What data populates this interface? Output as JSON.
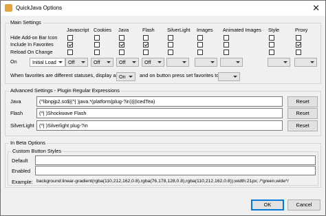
{
  "window": {
    "title": "QuickJava Options",
    "close_glyph": "✕"
  },
  "main_settings": {
    "label": "Main Settings",
    "columns": [
      "Javascript",
      "Cookies",
      "Java",
      "Flash",
      "SilverLight",
      "Images",
      "Animated Images",
      "Style",
      "Proxy"
    ],
    "rows": [
      {
        "label": "Hide Add-on Bar Icon",
        "checked": [
          false,
          false,
          false,
          false,
          false,
          false,
          false,
          false,
          false
        ]
      },
      {
        "label": "Include In Favorites",
        "checked": [
          true,
          false,
          true,
          true,
          false,
          false,
          false,
          false,
          true
        ]
      },
      {
        "label": "Reload On Change",
        "checked": [
          false,
          false,
          false,
          false,
          false,
          false,
          false,
          false,
          false
        ]
      }
    ],
    "on_label": "On",
    "on_dropdown": "Initial Load",
    "on_values": [
      "Off",
      "Off",
      "Off",
      "Off",
      "",
      "",
      "",
      "",
      ""
    ],
    "favorites_label": "When favorites are different statuses, display as",
    "favorites_display": "On",
    "press_label": "and on button press set favorites to",
    "press_value": ""
  },
  "advanced": {
    "label": "Advanced Settings - Plugin Regular Expressions",
    "rows": [
      {
        "label": "Java",
        "value": "(^libnpjp2.so$|(^| )java.*(platform|plug-?in))|(IcedTea)",
        "button": "Reset"
      },
      {
        "label": "Flash",
        "value": "(^| )Shockwave Flash",
        "button": "Reset"
      },
      {
        "label": "SilverLight",
        "value": "(^| )Silverlight plug-?in",
        "button": "Reset"
      }
    ]
  },
  "beta": {
    "label": "In Beta Options",
    "custom_label": "Custom Button Styles",
    "default_label": "Default",
    "default_value": "",
    "enabled_label": "Enabled",
    "enabled_value": "",
    "example_label": "Example:",
    "example_text": "background:linear-gradient(rgba(110,212,162,0.8),rgba(76,178,128,0.8),rgba(110,212,162,0.8));width:21px; /*green,wide*/"
  },
  "buttons": {
    "ok": "OK",
    "cancel": "Cancel"
  }
}
